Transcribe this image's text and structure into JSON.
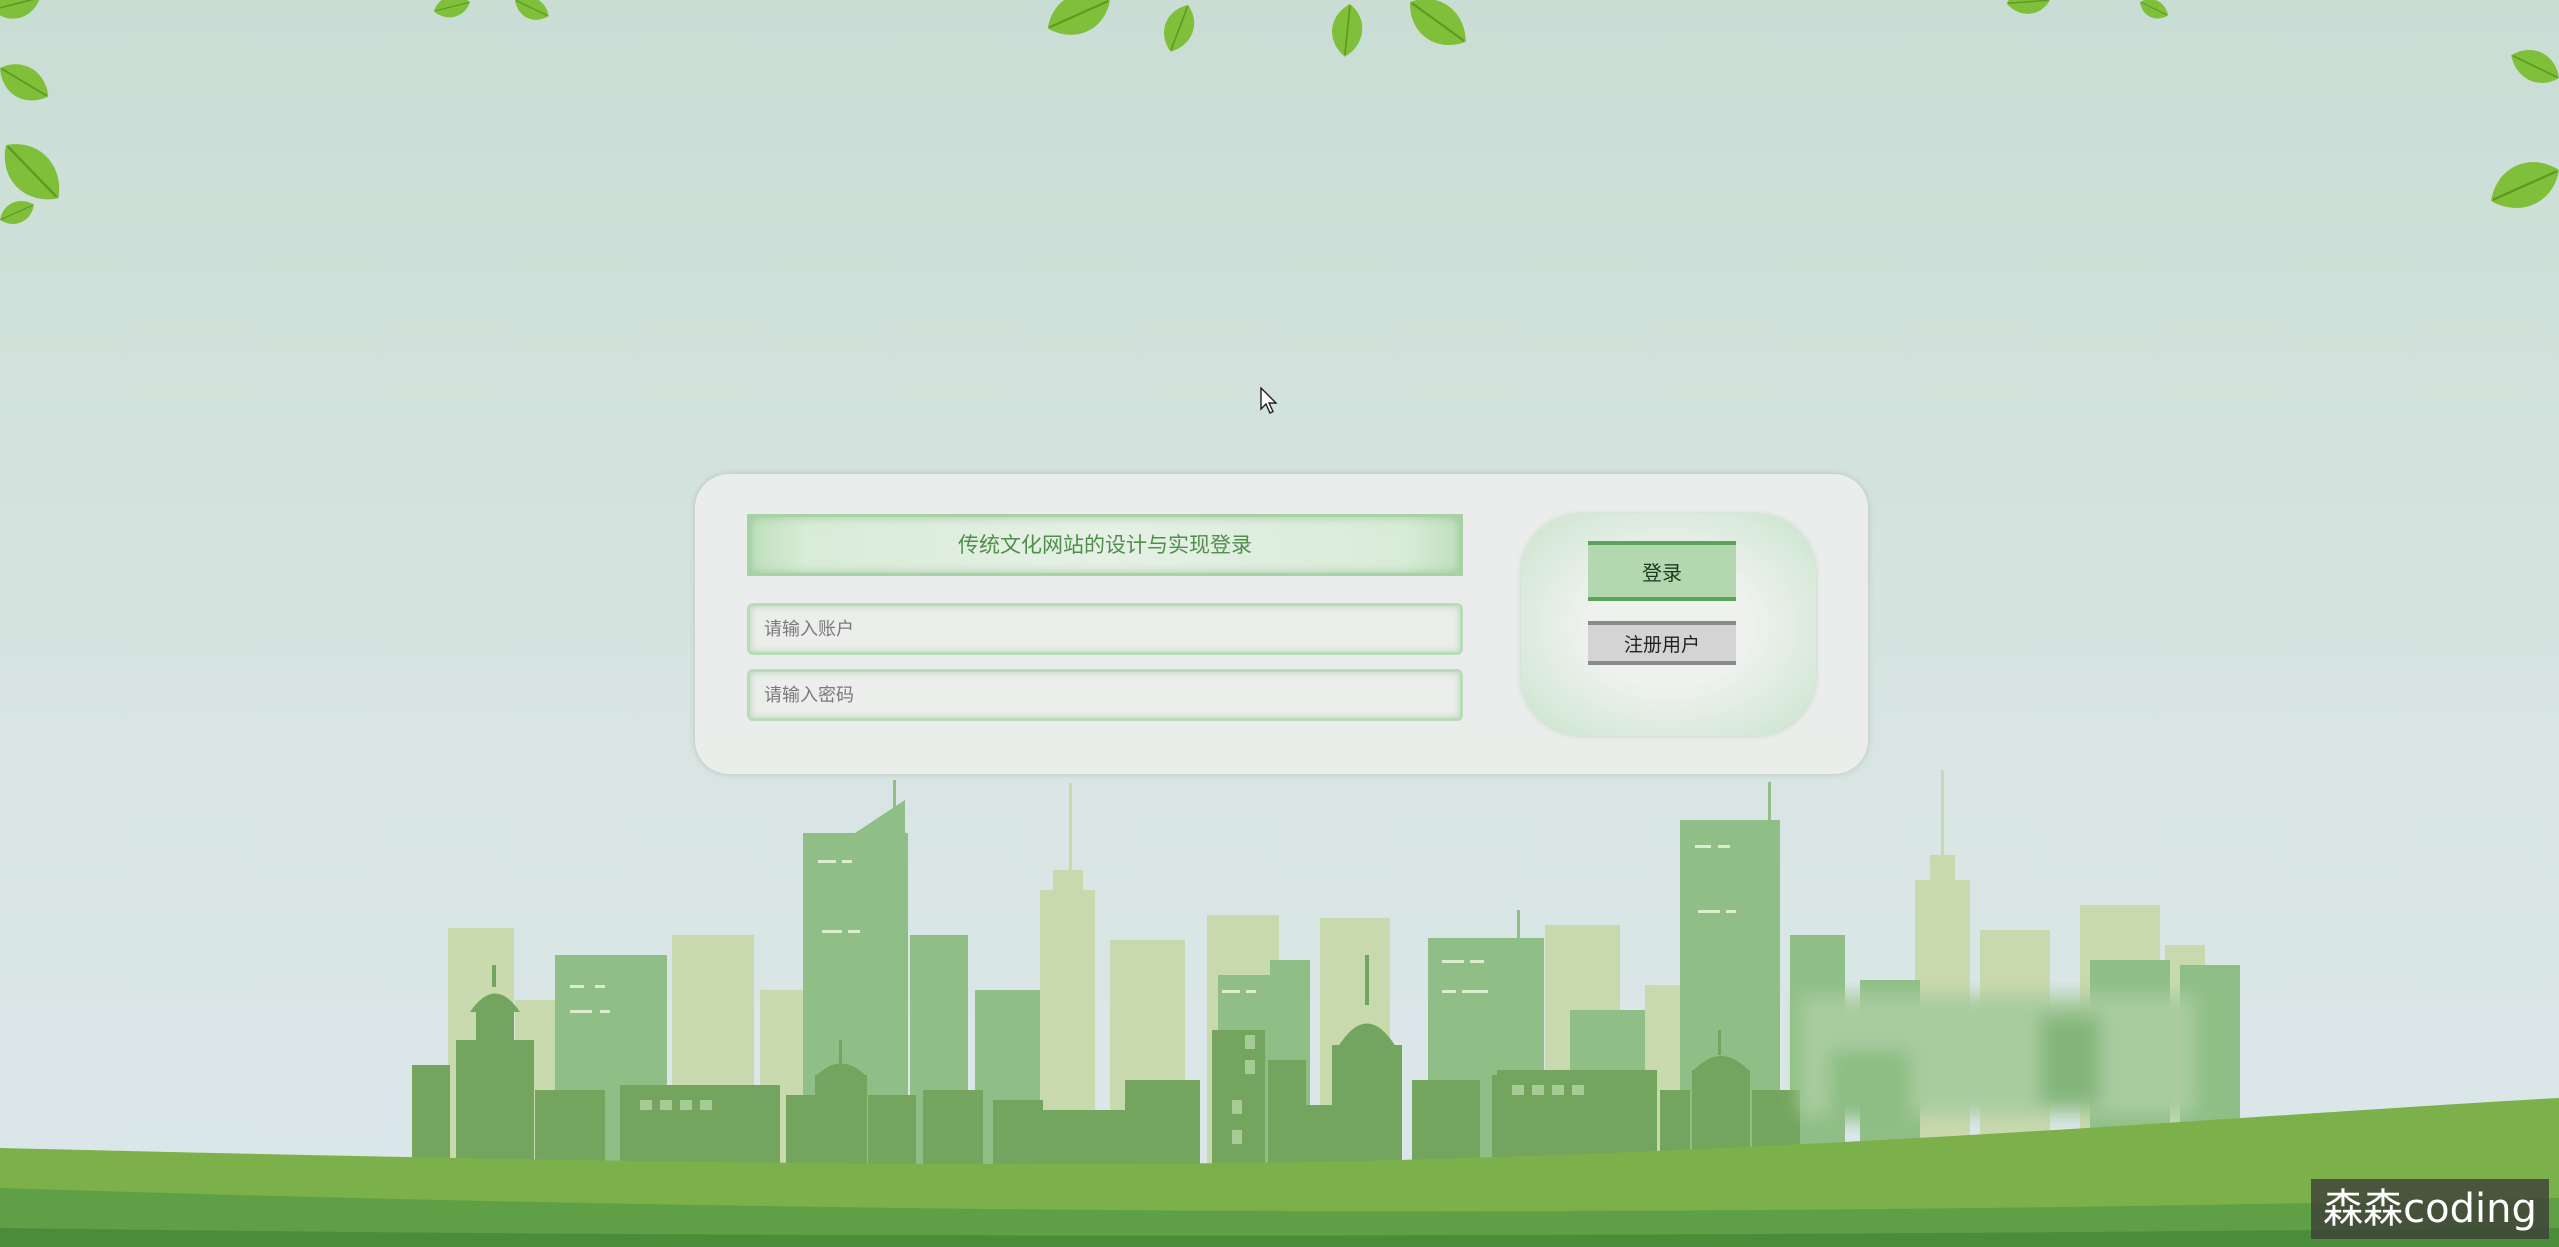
{
  "login": {
    "title": "传统文化网站的设计与实现登录",
    "account_placeholder": "请输入账户",
    "password_placeholder": "请输入密码",
    "login_label": "登录",
    "register_label": "注册用户"
  },
  "watermark": "森森coding",
  "colors": {
    "accent_green": "#5aa35a",
    "title_text": "#4f8f49",
    "login_button_bg": "#b3d8b0",
    "register_button_bg": "#d4d4d4",
    "grass": "#7bb04a"
  },
  "icons": [
    "leaf-icon",
    "mouse-cursor-icon"
  ]
}
